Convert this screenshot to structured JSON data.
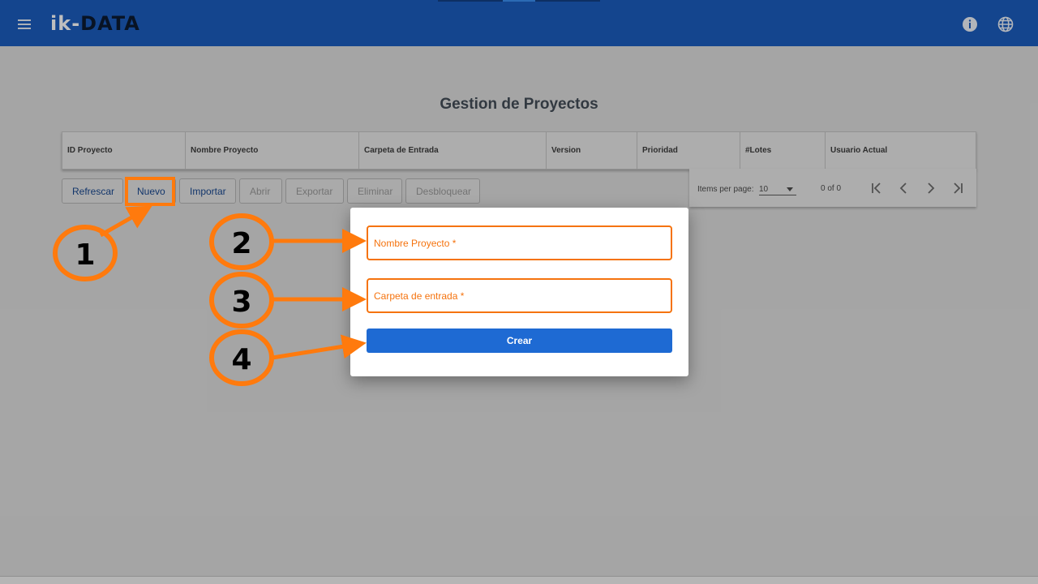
{
  "header": {
    "logo_prefix": "ik-",
    "logo_suffix": "DATA",
    "icons": [
      "menu-icon",
      "info-icon",
      "globe-icon"
    ]
  },
  "page": {
    "title": "Gestion de Proyectos"
  },
  "table": {
    "columns": [
      "ID Proyecto",
      "Nombre Proyecto",
      "Carpeta de Entrada",
      "Version",
      "Prioridad",
      "#Lotes",
      "Usuario Actual"
    ]
  },
  "toolbar": {
    "refresh": "Refrescar",
    "new": "Nuevo",
    "import": "Importar",
    "open": "Abrir",
    "export": "Exportar",
    "delete": "Eliminar",
    "unlock": "Desbloquear"
  },
  "paginator": {
    "items_label": "Items per page:",
    "page_size": "10",
    "range": "0 of 0"
  },
  "dialog": {
    "name_placeholder": "Nombre Proyecto *",
    "folder_placeholder": "Carpeta de entrada *",
    "create_label": "Crear"
  },
  "annotations": {
    "labels": [
      "1",
      "2",
      "3",
      "4"
    ],
    "color": "#ff7a0d"
  },
  "colors": {
    "primary": "#1b5dbe",
    "accent": "#f5730e"
  }
}
